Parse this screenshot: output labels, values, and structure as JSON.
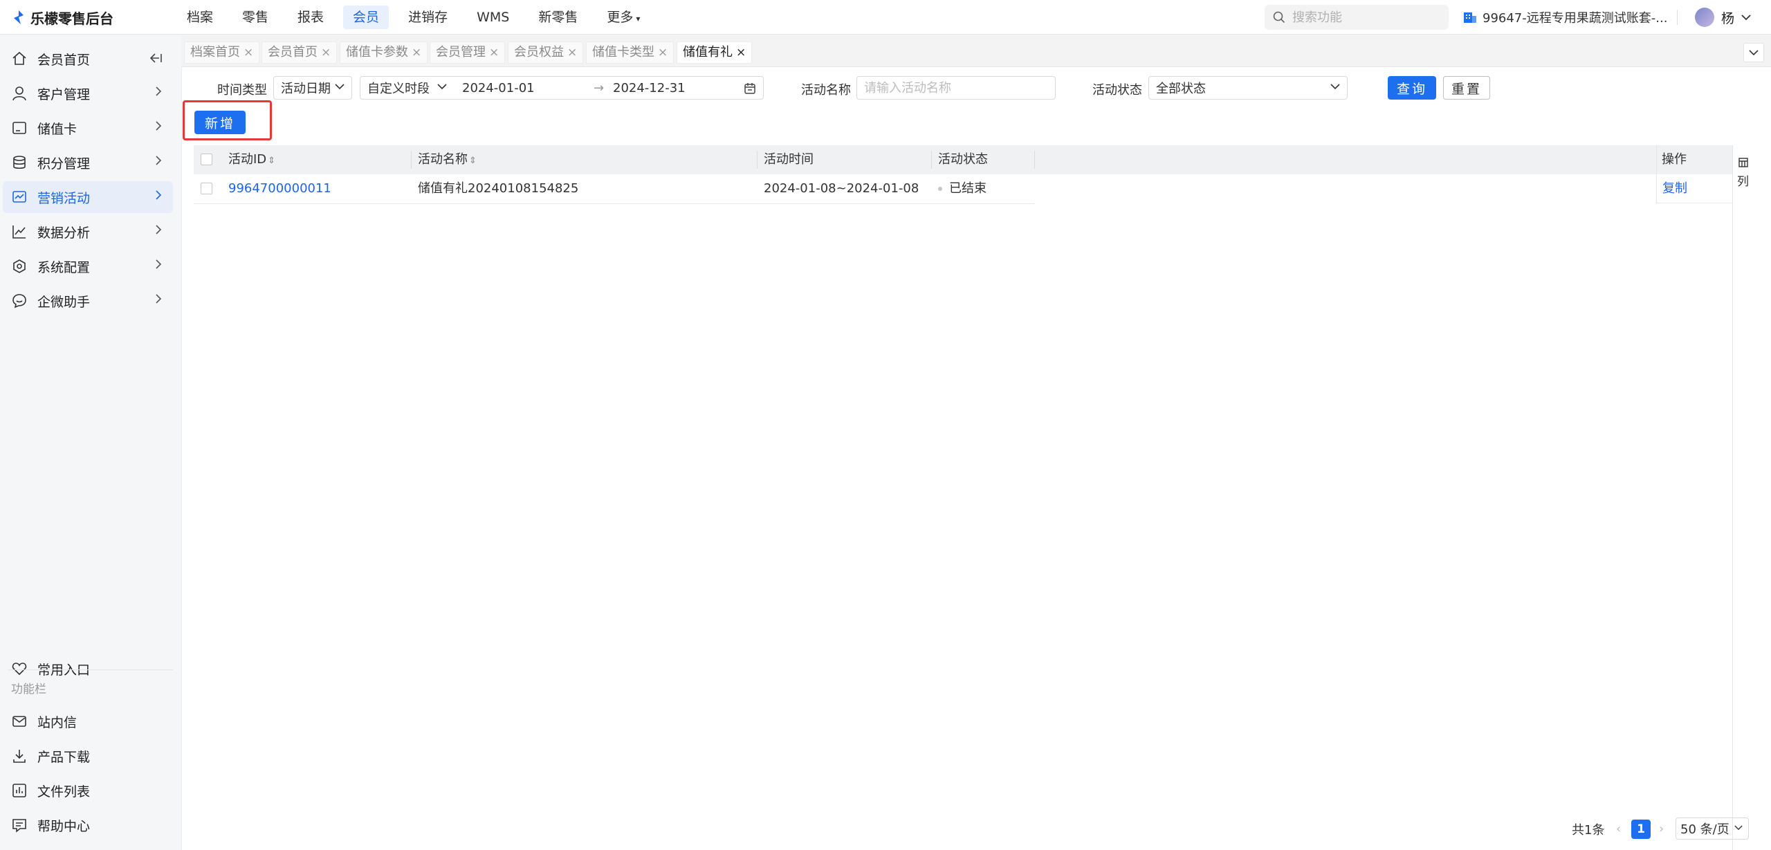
{
  "app": {
    "title": "乐檬零售后台"
  },
  "topnav": {
    "items": [
      "档案",
      "零售",
      "报表",
      "会员",
      "进销存",
      "WMS",
      "新零售",
      "更多"
    ],
    "active_index": 3
  },
  "search": {
    "placeholder": "搜索功能"
  },
  "account": {
    "name": "99647-远程专用果蔬测试账套-..."
  },
  "user": {
    "name": "杨"
  },
  "sidebar": {
    "items": [
      {
        "label": "会员首页",
        "icon": "home-icon"
      },
      {
        "label": "客户管理",
        "icon": "user-icon"
      },
      {
        "label": "储值卡",
        "icon": "card-icon"
      },
      {
        "label": "积分管理",
        "icon": "database-icon"
      },
      {
        "label": "营销活动",
        "icon": "marketing-icon"
      },
      {
        "label": "数据分析",
        "icon": "chart-icon"
      },
      {
        "label": "系统配置",
        "icon": "settings-icon"
      },
      {
        "label": "企微助手",
        "icon": "chat-icon"
      }
    ],
    "active_index": 4,
    "favorites_label": "常用入口",
    "section_title": "功能栏",
    "bottom_items": [
      {
        "label": "站内信",
        "icon": "mail-icon"
      },
      {
        "label": "产品下载",
        "icon": "download-icon"
      },
      {
        "label": "文件列表",
        "icon": "file-list-icon"
      },
      {
        "label": "帮助中心",
        "icon": "help-icon"
      }
    ]
  },
  "tabs": [
    {
      "label": "档案首页"
    },
    {
      "label": "会员首页"
    },
    {
      "label": "储值卡参数"
    },
    {
      "label": "会员管理"
    },
    {
      "label": "会员权益"
    },
    {
      "label": "储值卡类型"
    },
    {
      "label": "储值有礼",
      "active": true
    }
  ],
  "filters": {
    "time_type_label": "时间类型",
    "time_type_value": "活动日期",
    "period_value": "自定义时段",
    "start_date": "2024-01-01",
    "end_date": "2024-12-31",
    "range_sep": "→",
    "name_label": "活动名称",
    "name_placeholder": "请输入活动名称",
    "status_label": "活动状态",
    "status_value": "全部状态",
    "query_label": "查询",
    "reset_label": "重置"
  },
  "actions": {
    "add_label": "新增"
  },
  "table": {
    "headers": [
      "活动ID",
      "活动名称",
      "活动时间",
      "活动状态",
      "操作"
    ],
    "rows": [
      {
        "id": "9964700000011",
        "name": "储值有礼20240108154825",
        "time": "2024-01-08~2024-01-08",
        "status": "已结束",
        "action": "复制"
      }
    ],
    "column_setting_label": "列"
  },
  "pagination": {
    "total_text": "共1条",
    "current_page": "1",
    "page_size": "50 条/页"
  },
  "colors": {
    "primary": "#1e6ff0",
    "link": "#1e64e6",
    "highlight": "#e53935"
  }
}
